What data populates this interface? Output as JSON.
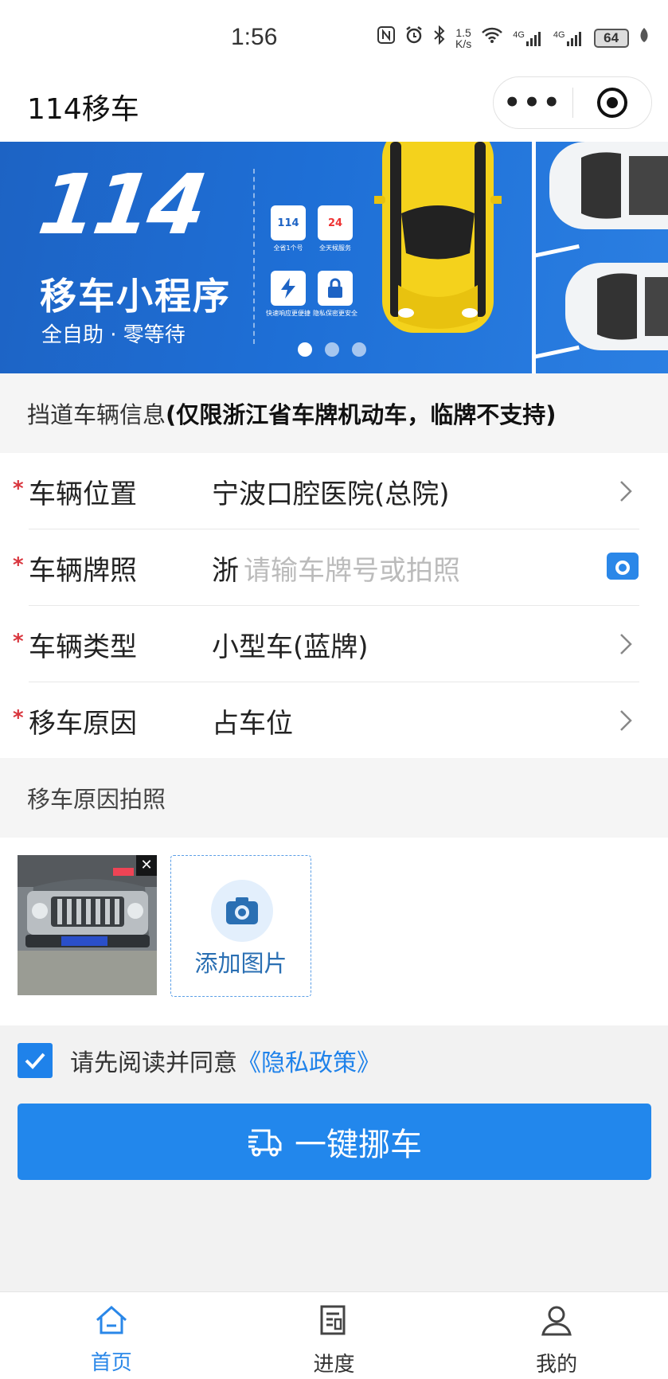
{
  "status_bar": {
    "time": "1:56",
    "network_speed_value": "1.5",
    "network_speed_unit": "K/s",
    "signal_1": "4G",
    "signal_2": "4G",
    "battery": "64"
  },
  "navbar": {
    "title": "114移车",
    "more_label": "•••"
  },
  "banner": {
    "big_text": "114",
    "subtitle": "移车小程序",
    "slogan": "全自助 · 零等待",
    "features": [
      {
        "badge": "114",
        "caption": "全省1个号",
        "icon": "province-map-icon"
      },
      {
        "badge": "24",
        "caption": "全天候服务",
        "icon": "clock-24-icon"
      },
      {
        "badge": "",
        "caption": "快速响应更便捷",
        "icon": "lightning-icon"
      },
      {
        "badge": "",
        "caption": "隐私保密更安全",
        "icon": "lock-icon"
      }
    ],
    "carousel": {
      "count": 3,
      "active": 0
    }
  },
  "section": {
    "prefix": "挡道车辆信息",
    "emphasis": "(仅限浙江省车牌机动车，临牌不支持)"
  },
  "form": {
    "rows": [
      {
        "label": "车辆位置",
        "value": "宁波口腔医院(总院)",
        "required": true
      },
      {
        "label": "车辆牌照",
        "prefix": "浙",
        "placeholder": "请输车牌号或拍照",
        "required": true
      },
      {
        "label": "车辆类型",
        "value": "小型车(蓝牌)",
        "required": true
      },
      {
        "label": "移车原因",
        "value": "占车位",
        "required": true
      }
    ],
    "required_mark": "*"
  },
  "photos": {
    "heading": "移车原因拍照",
    "remove_glyph": "✕",
    "add_label": "添加图片"
  },
  "agreement": {
    "text": "请先阅读并同意",
    "link": "《隐私政策》",
    "checked": true
  },
  "primary_button": {
    "label": "一键挪车"
  },
  "tabbar": {
    "tabs": [
      {
        "label": "首页",
        "icon": "home-icon",
        "active": true
      },
      {
        "label": "进度",
        "icon": "progress-document-icon",
        "active": false
      },
      {
        "label": "我的",
        "icon": "user-icon",
        "active": false
      }
    ]
  },
  "colors": {
    "primary": "#2287ec",
    "required": "#d9363e",
    "link": "#1f82ea"
  }
}
